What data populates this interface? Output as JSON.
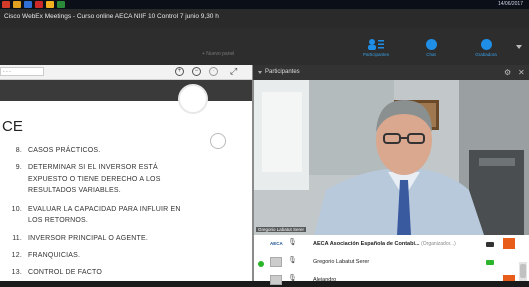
{
  "taskbar": {
    "date": "14/06/2017"
  },
  "window": {
    "title": "Cisco WebEx Meetings - Curso online AECA NIIF 10 Control 7 junio 9,30 h"
  },
  "toolbar": {
    "share_hint": "+ Nuevo panel",
    "participants_label": "Participantes",
    "chat_label": "Chat",
    "recorder_label": "Grabadora",
    "accent_color": "#1f8ee6"
  },
  "doc": {
    "page_field": "-  -  -",
    "slide_title": "CE",
    "items": [
      {
        "num": "8.",
        "text": "CASOS PRÁCTICOS."
      },
      {
        "num": "9.",
        "text": "DETERMINAR SI EL INVERSOR ESTÁ"
      },
      {
        "num": "",
        "text": "EXPUESTO O TIENE DERECHO A LOS"
      },
      {
        "num": "",
        "text": "RESULTADOS VARIABLES."
      },
      {
        "num": "10.",
        "text": "EVALUAR LA CAPACIDAD PARA INFLUIR EN"
      },
      {
        "num": "",
        "text": "LOS RETORNOS."
      },
      {
        "num": "11.",
        "text": "INVERSOR PRINCIPAL O AGENTE."
      },
      {
        "num": "12.",
        "text": "FRANQUICIAS."
      },
      {
        "num": "13.",
        "text": "CONTROL DE FACTO"
      }
    ]
  },
  "panel": {
    "title": "Participantes",
    "video_name": "Gregorio Labatut Serer",
    "participants": [
      {
        "name": "AECA Asociación Española de Contabi...",
        "meta": "(Organizador...)",
        "avatar": "AECA"
      },
      {
        "name": "Gregorio Labatut Serer",
        "meta": ""
      },
      {
        "name": "Alejandro",
        "meta": ""
      }
    ],
    "host_color": "#e85d1a",
    "online_color": "#2bb52b"
  }
}
